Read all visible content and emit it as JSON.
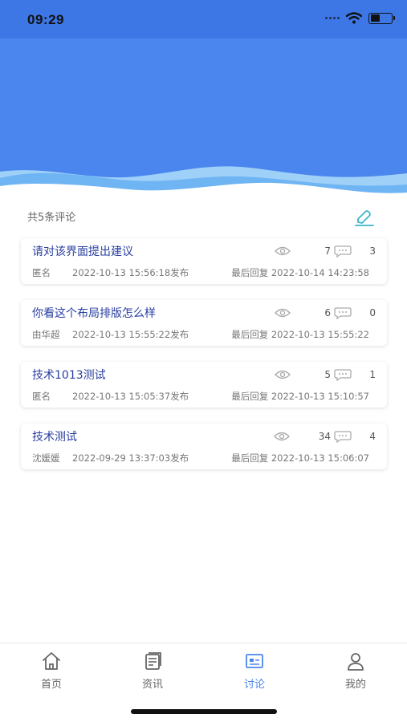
{
  "status_bar": {
    "time": "09:29"
  },
  "header": {
    "comment_count_text": "共5条评论",
    "edit_icon": "edit-icon"
  },
  "posts": [
    {
      "title": "请对该界面提出建议",
      "views": "7",
      "replies": "3",
      "author": "匿名",
      "posted": "2022-10-13 15:56:18发布",
      "last_reply": "最后回复 2022-10-14 14:23:58"
    },
    {
      "title": "你看这个布局排版怎么样",
      "views": "6",
      "replies": "0",
      "author": "由华超",
      "posted": "2022-10-13 15:55:22发布",
      "last_reply": "最后回复 2022-10-13 15:55:22"
    },
    {
      "title": "技术1013测试",
      "views": "5",
      "replies": "1",
      "author": "匿名",
      "posted": "2022-10-13 15:05:37发布",
      "last_reply": "最后回复 2022-10-13 15:10:57"
    },
    {
      "title": "技术测试",
      "views": "34",
      "replies": "4",
      "author": "沈媛媛",
      "posted": "2022-09-29 13:37:03发布",
      "last_reply": "最后回复 2022-10-13 15:06:07"
    }
  ],
  "tabbar": {
    "tabs": [
      {
        "label": "首页",
        "icon": "home-icon"
      },
      {
        "label": "资讯",
        "icon": "news-icon"
      },
      {
        "label": "讨论",
        "icon": "discussion-icon"
      },
      {
        "label": "我的",
        "icon": "user-icon"
      }
    ],
    "active_tab": "讨论"
  },
  "colors": {
    "primary": "#4a86ee",
    "title_text": "#2a3fa0",
    "wave_light": "#8fc4f5"
  }
}
